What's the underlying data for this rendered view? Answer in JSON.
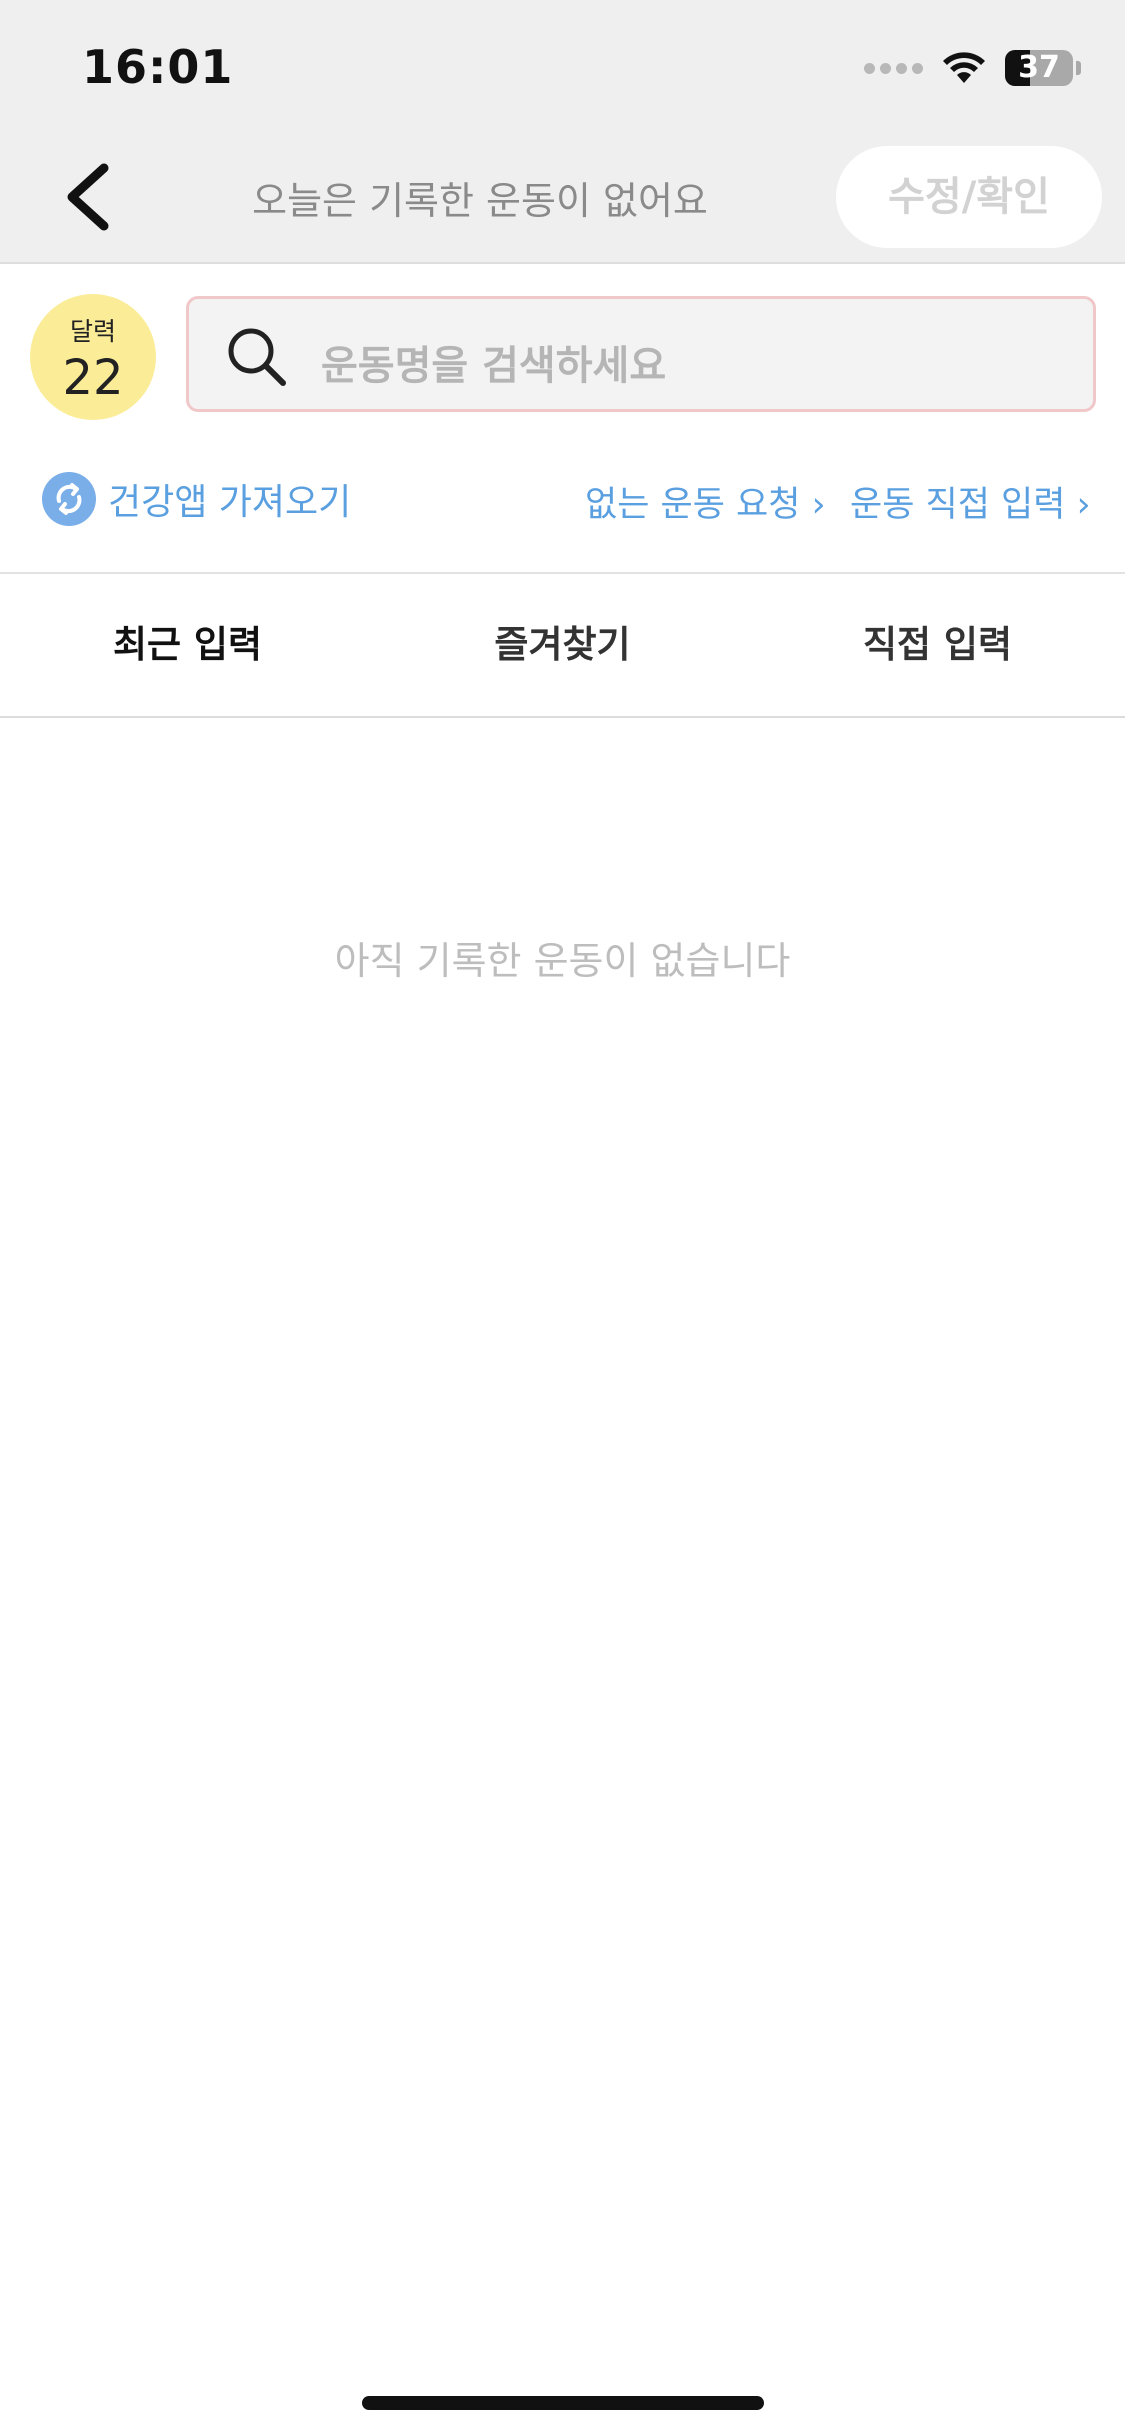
{
  "status_bar": {
    "time": "16:01",
    "battery_percent": "37",
    "battery_level": 0.37
  },
  "nav": {
    "back_icon": "chevron-left-icon",
    "title": "오늘은 기록한 운동이 없어요",
    "edit_confirm_label": "수정/확인"
  },
  "calendar": {
    "label": "달력",
    "day": "22",
    "color": "#fbed97"
  },
  "search": {
    "placeholder": "운동명을 검색하세요",
    "icon": "search-icon"
  },
  "links": {
    "health_import": "건강앱 가져오기",
    "request_missing": "없는 운동 요청 ›",
    "direct_input": "운동 직접 입력 ›",
    "color": "#5a9fe0"
  },
  "tabs": [
    {
      "label": "최근 입력",
      "active": true
    },
    {
      "label": "즐겨찾기",
      "active": false
    },
    {
      "label": "직접 입력",
      "active": false
    }
  ],
  "empty_state": {
    "message": "아직 기록한 운동이 없습니다"
  }
}
